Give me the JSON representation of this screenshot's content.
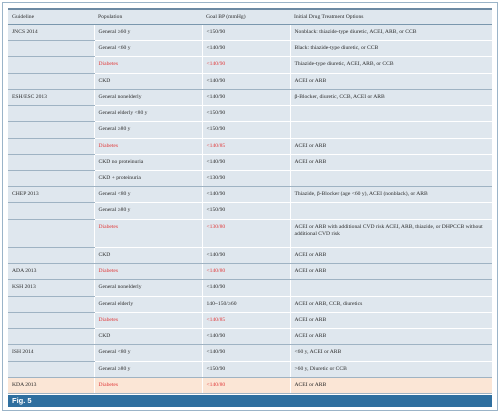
{
  "header": {
    "guideline": "Guideline",
    "population": "Population",
    "goal": "Goal BP (mmHg)",
    "options": "Initial Drug Treatment Options"
  },
  "rows": [
    {
      "g": "JNCS 2014",
      "p": "General ≥60 y",
      "b": "<150/90",
      "o": "Nonblack: thiazide-type diuretic, ACEI, ARB, or CCB"
    },
    {
      "g": "",
      "p": "General <60 y",
      "b": "<140/90",
      "o": "Black: thiazide-type diuretic, or CCB"
    },
    {
      "g": "",
      "p": "Diabetes",
      "b": "<140/90",
      "o": "Thiazide-type diuretic, ACEI, ARB, or CCB",
      "red": true
    },
    {
      "g": "",
      "p": "CKD",
      "b": "<140/90",
      "o": "ACEI or ARB"
    },
    {
      "g": "ESH/ESC 2013",
      "p": "General nonelderly",
      "b": "<140/90",
      "o": "β-Blocker, diuretic, CCB, ACEI or ARB"
    },
    {
      "g": "",
      "p": "General elderly <80 y",
      "b": "<150/90",
      "o": ""
    },
    {
      "g": "",
      "p": "General ≥80 y",
      "b": "<150/90",
      "o": ""
    },
    {
      "g": "",
      "p": "Diabetes",
      "b": "<140/85",
      "o": "ACEI or ARB",
      "red": true
    },
    {
      "g": "",
      "p": "CKD no proteinuria",
      "b": "<140/90",
      "o": "ACEI or ARB"
    },
    {
      "g": "",
      "p": "CKD + proteinuria",
      "b": "<130/90",
      "o": ""
    },
    {
      "g": "CHEP 2013",
      "p": "General <80 y",
      "b": "<140/90",
      "o": "Thiazide, β-Blocker (age <60 y), ACEI (nonblack), or ARB"
    },
    {
      "g": "",
      "p": "General ≥80 y",
      "b": "<150/90",
      "o": ""
    },
    {
      "g": "",
      "p": "Diabetes",
      "b": "<130/80",
      "o": "ACEI or ARB with additional CVD risk ACEI, ARB, thiazide, or DHPCCB without additional CVD risk",
      "red": true,
      "tall": true
    },
    {
      "g": "",
      "p": "CKD",
      "b": "<140/90",
      "o": "ACEI or ARB"
    },
    {
      "g": "ADA 2013",
      "p": "Diabetes",
      "b": "<140/80",
      "o": "ACEI or ARB",
      "red": true
    },
    {
      "g": "KSH 2013",
      "p": "General nonelderly",
      "b": "<140/90",
      "o": ""
    },
    {
      "g": "",
      "p": "General elderly",
      "b": "140~150/≥60",
      "o": "ACEI or ARB, CCB, diuretics"
    },
    {
      "g": "",
      "p": "Diabetes",
      "b": "<140/85",
      "o": "ACEI or ARB",
      "red": true
    },
    {
      "g": "",
      "p": "CKD",
      "b": "<140/90",
      "o": "ACEI or ARB"
    },
    {
      "g": "ISH 2014",
      "p": "General <80 y",
      "b": "<140/90",
      "o": "<60 y, ACEI or ARB"
    },
    {
      "g": "",
      "p": "General ≥80 y",
      "b": "<150/90",
      "o": ">60 y, Diuretic or CCB"
    },
    {
      "g": "KDA 2013",
      "p": "Diabetes",
      "b": "<140/80",
      "o": "ACEI or ARB",
      "red": true,
      "highlight": true
    }
  ],
  "caption": "Fig. 5"
}
